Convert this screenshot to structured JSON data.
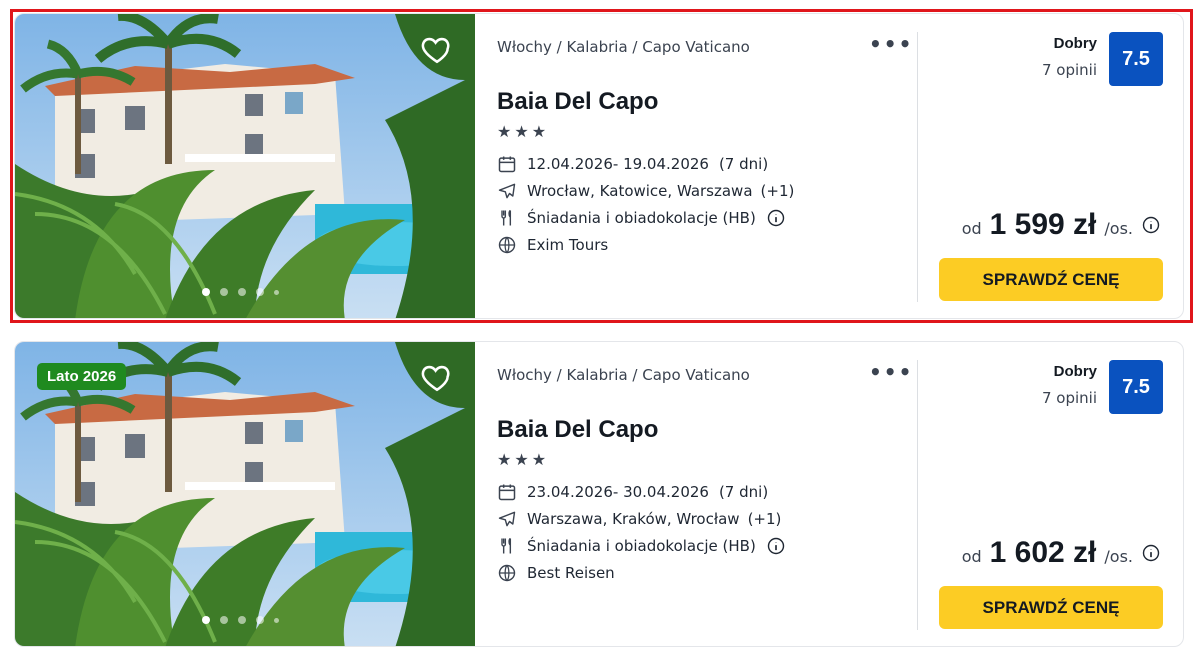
{
  "offers": [
    {
      "badge": "",
      "location": "Włochy / Kalabria / Capo Vaticano",
      "name": "Baia Del Capo",
      "stars": 3,
      "dates": "12.04.2026- 19.04.2026",
      "duration": "(7 dni)",
      "departure": "Wrocław, Katowice, Warszawa",
      "departure_more": "(+1)",
      "board": "Śniadania i obiadokolacje (HB)",
      "operator": "Exim Tours",
      "rating_label": "Dobry",
      "reviews": "7 opinii",
      "score": "7.5",
      "price_from": "od",
      "price": "1 599 zł",
      "price_unit": "/os.",
      "cta": "SPRAWDŹ CENĘ",
      "gallery_active_index": 0
    },
    {
      "badge": "Lato 2026",
      "location": "Włochy / Kalabria / Capo Vaticano",
      "name": "Baia Del Capo",
      "stars": 3,
      "dates": "23.04.2026- 30.04.2026",
      "duration": "(7 dni)",
      "departure": "Warszawa, Kraków, Wrocław",
      "departure_more": "(+1)",
      "board": "Śniadania i obiadokolacje (HB)",
      "operator": "Best Reisen",
      "rating_label": "Dobry",
      "reviews": "7 opinii",
      "score": "7.5",
      "price_from": "od",
      "price": "1 602 zł",
      "price_unit": "/os.",
      "cta": "SPRAWDŹ CENĘ",
      "gallery_active_index": 0
    }
  ],
  "colors": {
    "score_bg": "#0a52bf",
    "cta_bg": "#fccc24",
    "badge_bg": "#1f8a1f",
    "highlight_border": "#e0161b"
  },
  "icons": [
    "heart-icon",
    "more-icon",
    "star-icon",
    "calendar-icon",
    "plane-icon",
    "cutlery-icon",
    "info-icon",
    "globe-icon"
  ]
}
